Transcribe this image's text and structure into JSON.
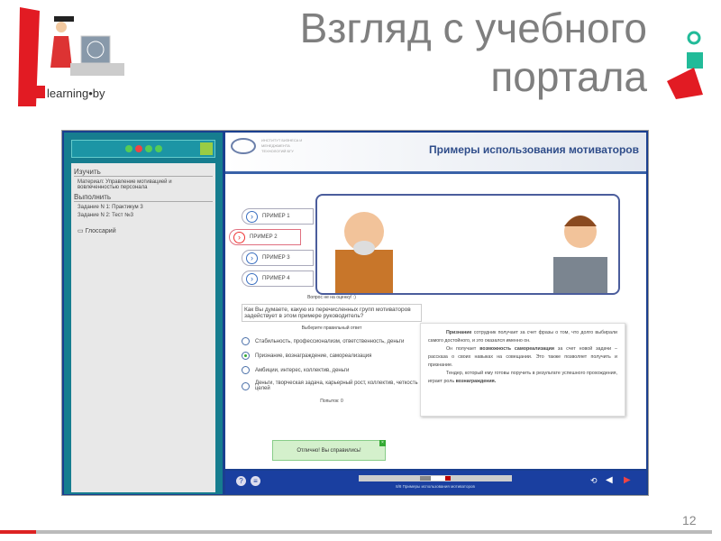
{
  "slide": {
    "title_line1": "Взгляд с учебного",
    "title_line2": "портала",
    "page_number": "12",
    "logo_text": "E-learning.by"
  },
  "sidebar": {
    "sections": [
      {
        "heading": "Изучить",
        "items": [
          "Материал: Управление мотивацией и вовлеченностью персонала"
        ]
      },
      {
        "heading": "Выполнить",
        "items": [
          "Задание N 1: Практикум 3",
          "Задание N 2: Тест №3"
        ]
      }
    ],
    "glossary": "Глоссарий"
  },
  "header": {
    "institute": "ИНСТИТУТ БИЗНЕСА И МЕНЕДЖМЕНТА ТЕХНОЛОГИЙ БГУ",
    "title": "Примеры использования мотиваторов"
  },
  "examples": [
    "ПРИМЕР 1",
    "ПРИМЕР 2",
    "ПРИМЕР 3",
    "ПРИМЕР 4"
  ],
  "selected_example": 2,
  "question": {
    "caption": "Вопрос не на оценку! :)",
    "text": "Как Вы думаете, какую из перечисленных групп мотиваторов задействует в этом примере руководитель?",
    "instruction": "Выберите правильный ответ",
    "options": [
      "Стабильность, профессионализм, ответственность, деньги",
      "Признание, вознаграждение, самореализация",
      "Амбиции, интерес, коллектив, деньги",
      "Деньги, творческая задача, карьерный рост, коллектив, четкость целей"
    ],
    "selected": 2,
    "attempts": "Попыток: 0",
    "feedback": "Отлично! Вы справились!"
  },
  "explanation": {
    "p1_bold": "Признание",
    "p1": " сотрудник получает за счет фразы о том, что долго выбирали самого достойного, и это оказался именно он.",
    "p2a": "Он получает ",
    "p2_bold": "возможность самореализации",
    "p2b": " за счет новой задачи – рассказа о своих навыках на совещании. Это также позволяет получить и признание.",
    "p3a": "Тендер, который ему готовы поручить в результате успешного прохождения, играет роль ",
    "p3_bold": "вознаграждения."
  },
  "footer": {
    "caption": "8/8 Примеры использования мотиваторов",
    "progress": "8/8"
  }
}
